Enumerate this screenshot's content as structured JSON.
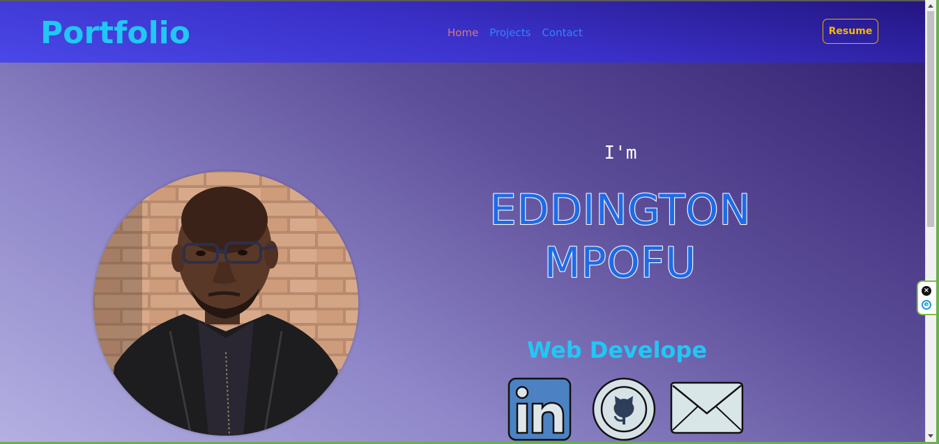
{
  "header": {
    "logo": "Portfolio",
    "nav": [
      {
        "label": "Home"
      },
      {
        "label": "Projects"
      },
      {
        "label": "Contact"
      }
    ],
    "resume_label": "Resume"
  },
  "hero": {
    "intro": "I'm",
    "name_line1": "EDDINGTON",
    "name_line2": "MPOFU",
    "role": "Web Develope"
  },
  "social": [
    {
      "icon": "linkedin-icon"
    },
    {
      "icon": "github-icon"
    },
    {
      "icon": "email-icon"
    }
  ],
  "extension": {
    "close_glyph": "×",
    "logo_glyph": "e"
  },
  "colors": {
    "accent": "#21c7f5",
    "name_blue": "#1f6be6",
    "resume_gold": "#f5b700",
    "nav_home": "#d87a7a",
    "nav_link": "#2d86ff"
  }
}
